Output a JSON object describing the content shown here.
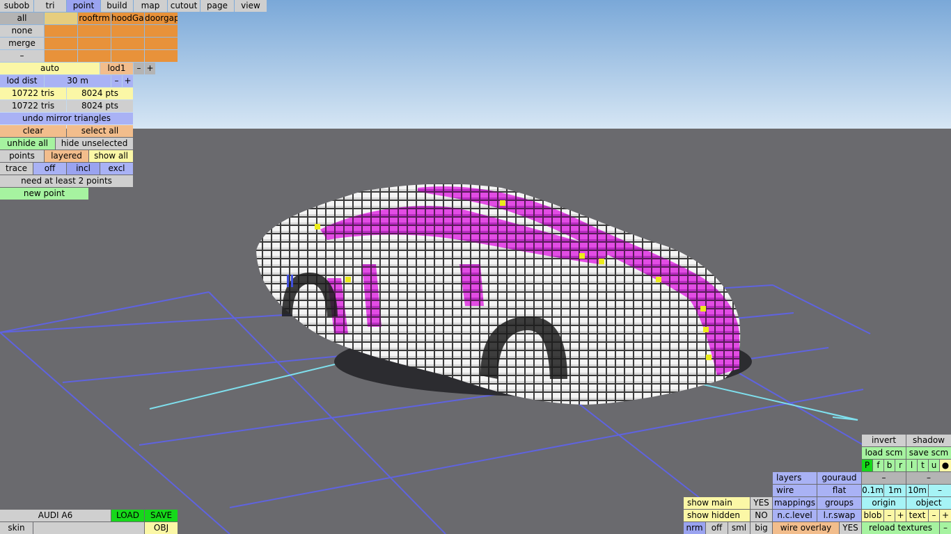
{
  "menu": {
    "items": [
      "subob",
      "tri",
      "point",
      "build",
      "map",
      "cutout",
      "page",
      "view"
    ],
    "active": "point"
  },
  "layers": {
    "rows": [
      "all",
      "none",
      "merge",
      "–"
    ],
    "headers": [
      "",
      "rooftrm",
      "hoodGap",
      "doorgap"
    ]
  },
  "lod": {
    "auto": "auto",
    "level": "lod1",
    "minus": "–",
    "plus": "+"
  },
  "lod_dist": {
    "label": "lod dist",
    "value": "30 m",
    "minus": "–",
    "plus": "+"
  },
  "stats": {
    "tris1": "10722 tris",
    "pts1": "8024 pts",
    "tris2": "10722 tris",
    "pts2": "8024 pts"
  },
  "buttons": {
    "undo_mirror": "undo mirror triangles",
    "clear": "clear",
    "select_all": "select all",
    "unhide_all": "unhide all",
    "hide_unselected": "hide unselected",
    "points": "points",
    "layered": "layered",
    "show_all": "show all",
    "trace": "trace",
    "off": "off",
    "incl": "incl",
    "excl": "excl",
    "status": "need at least 2 points",
    "new_point": "new point"
  },
  "file": {
    "name": "AUDI A6",
    "load": "LOAD",
    "save": "SAVE",
    "skin": "skin",
    "obj": "OBJ"
  },
  "view": {
    "show_main": "show main",
    "show_main_val": "YES",
    "show_hidden": "show hidden",
    "show_hidden_val": "NO",
    "nrm": "nrm",
    "off": "off",
    "sml": "sml",
    "big": "big",
    "layers": "layers",
    "gouraud": "gouraud",
    "wire": "wire",
    "flat": "flat",
    "mappings": "mappings",
    "groups": "groups",
    "nclevel": "n.c.level",
    "lrswap": "l.r.swap",
    "wire_overlay": "wire overlay",
    "wire_overlay_val": "YES"
  },
  "scm": {
    "invert": "invert",
    "shadow": "shadow",
    "load_scm": "load scm",
    "save_scm": "save scm",
    "letters": [
      "P",
      "f",
      "b",
      "r",
      "l",
      "t",
      "u",
      "●"
    ],
    "dash1": "–",
    "dash2": "–",
    "d01": "0.1m",
    "d1": "1m",
    "d10": "10m",
    "dm": "–",
    "origin": "origin",
    "object": "object",
    "blob": "blob",
    "blob_minus": "–",
    "blob_plus": "+",
    "text": "text",
    "text_minus": "–",
    "text_plus": "+",
    "reload": "reload textures",
    "reload_minus": "–"
  },
  "colors": {
    "sky_top": "#7aa8d8",
    "sky_bottom": "#d6e6f4",
    "ground": "#6a6a6e",
    "grid": "#5f63e0",
    "axis": "#7fe0ee",
    "car_white": "#f2f2f2",
    "car_magenta": "#dd3fe0",
    "car_yellow": "#ecec1a"
  }
}
